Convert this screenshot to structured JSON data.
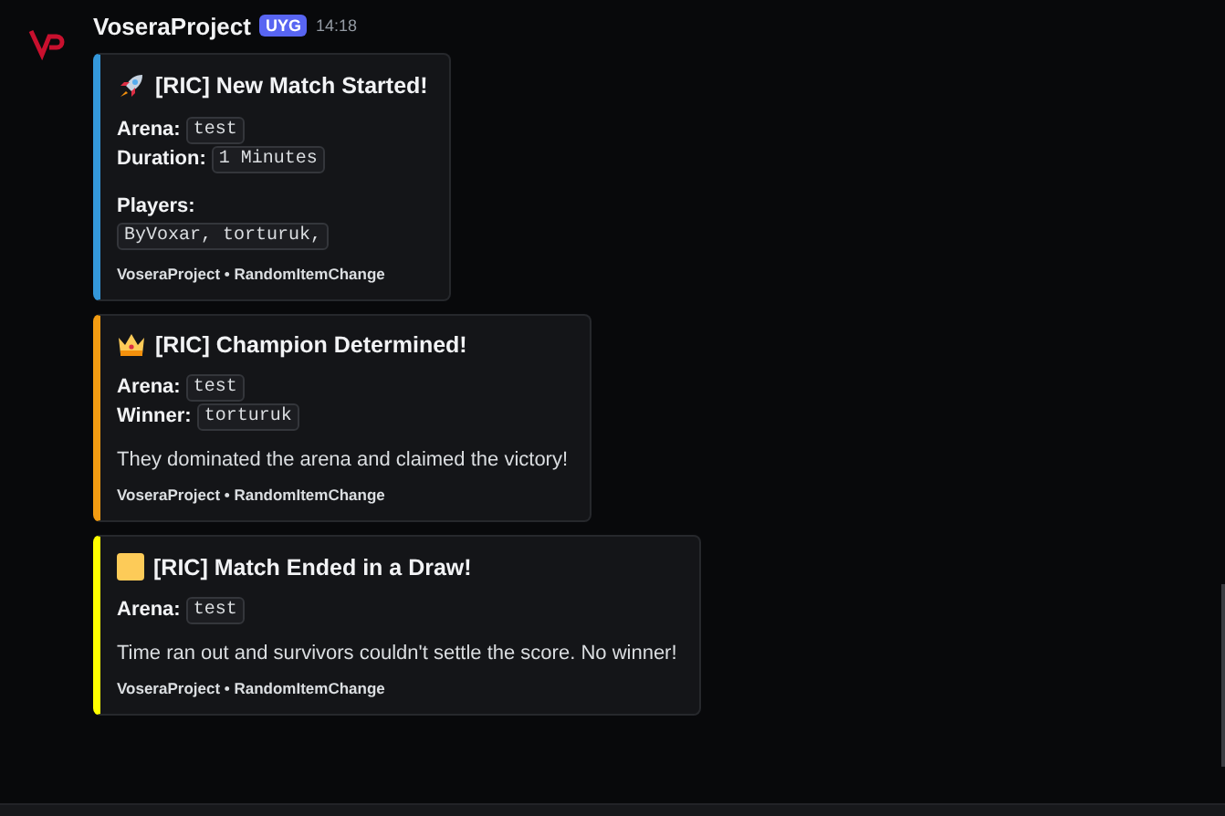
{
  "message": {
    "author": "VoseraProject",
    "tag": "UYG",
    "time": "14:18"
  },
  "embeds": [
    {
      "color": "#3498db",
      "kind": "rocket",
      "title": "[RIC] New Match Started!",
      "fields": [
        {
          "kind": "inline",
          "label": "Arena:",
          "value": "test"
        },
        {
          "kind": "inline",
          "label": "Duration:",
          "value": "1 Minutes"
        },
        {
          "kind": "block",
          "label": "Players:",
          "value": "ByVoxar, torturuk,"
        }
      ],
      "footer": "VoseraProject • RandomItemChange"
    },
    {
      "color": "#f39c12",
      "kind": "crown",
      "title": "[RIC] Champion Determined!",
      "fields": [
        {
          "kind": "inline",
          "label": "Arena:",
          "value": "test"
        },
        {
          "kind": "inline",
          "label": "Winner:",
          "value": "torturuk"
        }
      ],
      "description": "They dominated the arena and claimed the victory!",
      "footer": "VoseraProject • RandomItemChange"
    },
    {
      "color": "#ffff00",
      "kind": "square",
      "title": "[RIC] Match Ended in a Draw!",
      "fields": [
        {
          "kind": "inline",
          "label": "Arena:",
          "value": "test"
        }
      ],
      "description": "Time ran out and survivors couldn't settle the score. No winner!",
      "footer": "VoseraProject • RandomItemChange"
    }
  ]
}
